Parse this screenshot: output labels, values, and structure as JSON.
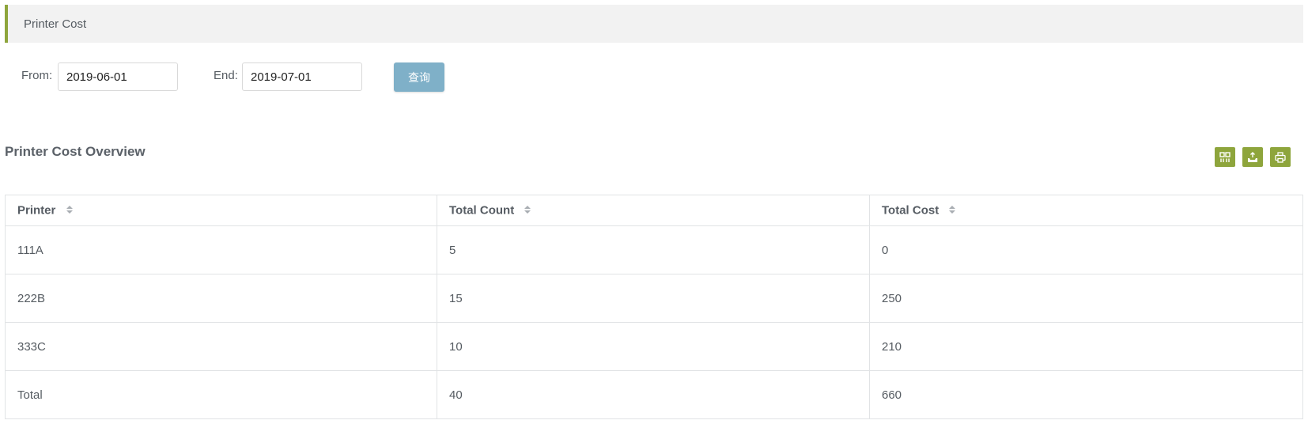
{
  "header": {
    "title": "Printer Cost"
  },
  "filter": {
    "from_label": "From:",
    "from_value": "2019-06-01",
    "end_label": "End:",
    "end_value": "2019-07-01",
    "query_label": "查询"
  },
  "section": {
    "title": "Printer Cost Overview"
  },
  "toolbar": {
    "buttons": [
      {
        "icon": "columns-icon"
      },
      {
        "icon": "export-icon"
      },
      {
        "icon": "print-icon"
      }
    ]
  },
  "table": {
    "columns": [
      "Printer",
      "Total Count",
      "Total Cost"
    ],
    "rows": [
      [
        "111A",
        "5",
        "0"
      ],
      [
        "222B",
        "15",
        "250"
      ],
      [
        "333C",
        "10",
        "210"
      ],
      [
        "Total",
        "40",
        "660"
      ]
    ]
  },
  "colors": {
    "accent": "#8ea53c",
    "query_button": "#7fb0c8",
    "title_bar_bg": "#f2f2f2"
  }
}
